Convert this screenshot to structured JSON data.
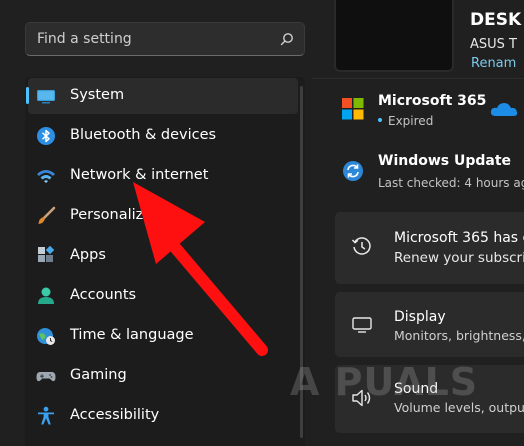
{
  "search": {
    "placeholder": "Find a setting"
  },
  "sidebar": {
    "items": [
      {
        "label": "System",
        "selected": true
      },
      {
        "label": "Bluetooth & devices"
      },
      {
        "label": "Network & internet"
      },
      {
        "label": "Personaliza"
      },
      {
        "label": "Apps"
      },
      {
        "label": "Accounts"
      },
      {
        "label": "Time & language"
      },
      {
        "label": "Gaming"
      },
      {
        "label": "Accessibility"
      }
    ]
  },
  "device": {
    "name": "DESK",
    "model": "ASUS T",
    "rename": "Renam"
  },
  "status": {
    "m365": {
      "title": "Microsoft 365",
      "status": "Expired"
    },
    "update": {
      "title": "Windows Update",
      "last_checked": "Last checked: 4 hours ago"
    }
  },
  "cards": [
    {
      "title": "Microsoft 365 has e",
      "subtitle": "Renew your subscri"
    },
    {
      "title": "Display",
      "subtitle": "Monitors, brightness, "
    },
    {
      "title": "Sound",
      "subtitle": "Volume levels, output, "
    }
  ],
  "watermark": "A  PUALS",
  "colors": {
    "accent": "#4cc2ff",
    "annotation_arrow": "#ff1010",
    "background": "#202020"
  }
}
